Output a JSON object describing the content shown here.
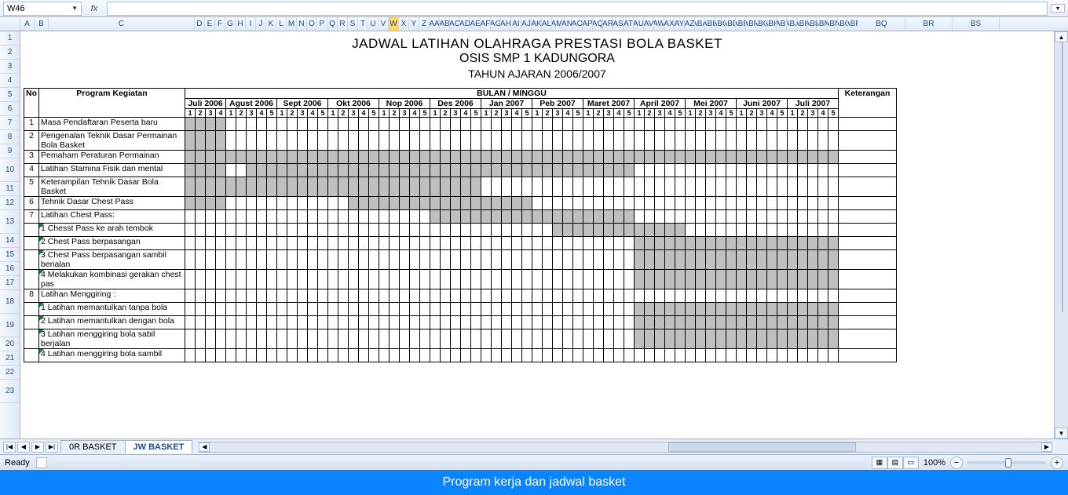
{
  "formula_bar": {
    "cell_ref": "W46",
    "fx_label": "fx",
    "formula_value": ""
  },
  "columns_first": [
    "A",
    "B",
    "C"
  ],
  "columns_first_widths": [
    18,
    18,
    186
  ],
  "columns_wide": [
    "BQ",
    "BR",
    "BS"
  ],
  "selected_col": "W",
  "row_numbers": [
    1,
    2,
    3,
    4,
    5,
    6,
    7,
    8,
    9,
    10,
    11,
    12,
    13,
    14,
    15,
    16,
    17,
    18,
    19,
    20,
    21,
    22,
    23
  ],
  "row_heights": {
    "10": 30,
    "13": 30,
    "18": 30,
    "19": 30,
    "23": 30
  },
  "titles": {
    "line1": "JADWAL LATIHAN OLAHRAGA PRESTASI BOLA BASKET",
    "line2": "OSIS SMP 1 KADUNGORA",
    "line3": "TAHUN AJARAN 2006/2007"
  },
  "headers": {
    "no": "No",
    "program": "Program Kegiatan",
    "group": "BULAN / MINGGU",
    "ket": "Keterangan",
    "months": [
      {
        "name": "Juli 2006",
        "weeks": 4
      },
      {
        "name": "Agust 2006",
        "weeks": 5
      },
      {
        "name": "Sept 2006",
        "weeks": 5
      },
      {
        "name": "Okt 2006",
        "weeks": 5
      },
      {
        "name": "Nop 2006",
        "weeks": 5
      },
      {
        "name": "Des 2006",
        "weeks": 5
      },
      {
        "name": "Jan 2007",
        "weeks": 5
      },
      {
        "name": "Peb 2007",
        "weeks": 5
      },
      {
        "name": "Maret  2007",
        "weeks": 5
      },
      {
        "name": "April 2007",
        "weeks": 5
      },
      {
        "name": "Mei 2007",
        "weeks": 5
      },
      {
        "name": "Juni 2007",
        "weeks": 5
      },
      {
        "name": "Juli 2007",
        "weeks": 5
      }
    ]
  },
  "rows": [
    {
      "no": "1",
      "text": "Masa Pendaftaran Peserta baru",
      "fill_start": 0,
      "fill_end": 3
    },
    {
      "no": "2",
      "text": "Pengenalan Teknik Dasar Permainan Bola Basket",
      "fill_start": 0,
      "fill_end": 3,
      "multi": true
    },
    {
      "no": "3",
      "text": "Pemaham Peraturan Permainan",
      "fill_start": 0,
      "fill_end": 63
    },
    {
      "no": "4",
      "text": "Latihan Stamina  Fisik dan mental",
      "fill_start": 0,
      "fill_end": 3,
      "ranges": [
        [
          0,
          3
        ],
        [
          6,
          43
        ]
      ]
    },
    {
      "no": "5",
      "text": "Keterampilan Tehnik Dasar Bola Basket",
      "fill_start": 0,
      "fill_end": 28,
      "multi": true
    },
    {
      "no": "6",
      "text": "Tehnik Dasar Chest Pass",
      "fill_start": 0,
      "fill_end": 3,
      "ranges": [
        [
          0,
          3
        ],
        [
          16,
          33
        ]
      ]
    },
    {
      "no": "7",
      "text": "Latihan Chest Pass:",
      "ranges": [
        [
          24,
          43
        ]
      ]
    },
    {
      "no": "",
      "text": "1 Chesst Pass ke arah tembok",
      "sub": true,
      "tri": true,
      "ranges": [
        [
          36,
          48
        ]
      ]
    },
    {
      "no": "",
      "text": "2 Chest Pass berpasangan",
      "sub": true,
      "tri": true,
      "ranges": [
        [
          44,
          63
        ]
      ]
    },
    {
      "no": "",
      "text": "3 Chest Pass berpasangan sambil berialan",
      "sub": true,
      "tri": true,
      "multi": true,
      "ranges": [
        [
          44,
          63
        ]
      ]
    },
    {
      "no": "",
      "text": "4 Melakukan kombinasi gerakan chest pas",
      "sub": true,
      "tri": true,
      "multi": true,
      "ranges": [
        [
          44,
          63
        ]
      ]
    },
    {
      "no": "8",
      "text": "Latihan Menggiring :"
    },
    {
      "no": "",
      "text": "1 Latihan memantulkan tanpa bola",
      "sub": true,
      "tri": true,
      "ranges": [
        [
          44,
          63
        ]
      ]
    },
    {
      "no": "",
      "text": "2 Latihan memantulkan dengan bola",
      "sub": true,
      "tri": true,
      "ranges": [
        [
          44,
          63
        ]
      ]
    },
    {
      "no": "",
      "text": "3 Latihan menggiring bola sabil berjalan",
      "sub": true,
      "tri": true,
      "multi": true,
      "ranges": [
        [
          44,
          63
        ]
      ]
    },
    {
      "no": "",
      "text": "4 Latihan menggiring bola sambil",
      "sub": true,
      "tri": true
    }
  ],
  "tabs": {
    "items": [
      "0R BASKET",
      "JW BASKET"
    ],
    "active": 1
  },
  "status": {
    "ready": "Ready",
    "zoom": "100%"
  },
  "caption": "Program kerja dan jadwal basket"
}
